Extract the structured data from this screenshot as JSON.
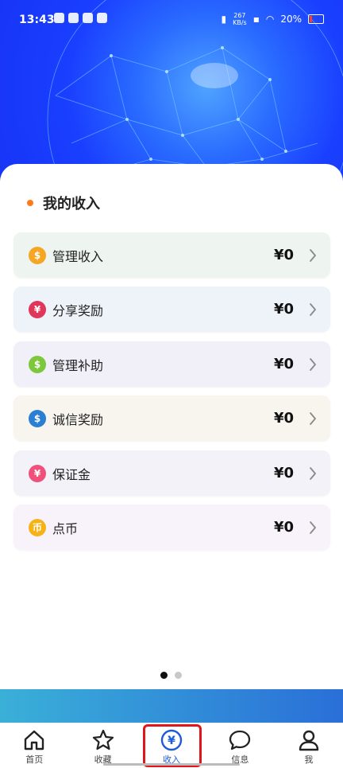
{
  "status": {
    "time": "13:43",
    "net_speed": "267",
    "net_unit": "KB/s",
    "battery": "20%"
  },
  "section": {
    "title": "我的收入"
  },
  "rows": [
    {
      "label": "管理收入",
      "amount": "¥0",
      "icon": "coin-icon",
      "icon_char": "$",
      "icon_color": "#f5a623",
      "bg": "#eef5f0"
    },
    {
      "label": "分享奖励",
      "amount": "¥0",
      "icon": "yuan-icon",
      "icon_char": "¥",
      "icon_color": "#e0365a",
      "bg": "#eef3f9"
    },
    {
      "label": "管理补助",
      "amount": "¥0",
      "icon": "dollar-icon",
      "icon_char": "$",
      "icon_color": "#7cc73b",
      "bg": "#f1f0f8"
    },
    {
      "label": "诚信奖励",
      "amount": "¥0",
      "icon": "money-bag-icon",
      "icon_char": "$",
      "icon_color": "#2a7fd4",
      "bg": "#f7f5ee"
    },
    {
      "label": "保证金",
      "amount": "¥0",
      "icon": "wallet-icon",
      "icon_char": "¥",
      "icon_color": "#f0507a",
      "bg": "#f3f2f8"
    },
    {
      "label": "点币",
      "amount": "¥0",
      "icon": "coin-icon",
      "icon_char": "币",
      "icon_color": "#f5b318",
      "bg": "#f8f3fa"
    }
  ],
  "pager": {
    "count": 2,
    "active": 0
  },
  "tabs": [
    {
      "label": "首页",
      "icon": "home-icon"
    },
    {
      "label": "收藏",
      "icon": "star-icon"
    },
    {
      "label": "收入",
      "icon": "yuan-circle-icon",
      "active": true
    },
    {
      "label": "信息",
      "icon": "chat-icon"
    },
    {
      "label": "我",
      "icon": "user-icon"
    }
  ],
  "colors": {
    "accent": "#1e5bd8",
    "hero": "#1a3fff",
    "highlight": "#e0161b",
    "dot": "#ff7a1a"
  }
}
